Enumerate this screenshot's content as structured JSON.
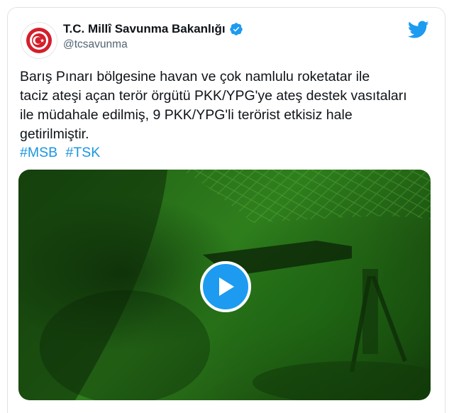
{
  "tweet": {
    "display_name": "T.C. Millî Savunma Bakanlığı",
    "handle": "@tcsavunma",
    "text_lines": [
      "Barış Pınarı bölgesine havan ve çok namlulu roketatar ile",
      "taciz ateşi açan terör örgütü PKK/YPG'ye ateş destek vasıtaları",
      "ile müdahale edilmiş, 9 PKK/YPG'li terörist etkisiz hale",
      "getirilmiştir."
    ],
    "hashtags": [
      "#MSB",
      "#TSK"
    ]
  },
  "icons": {
    "avatar": "ministry-seal-icon",
    "verified": "verified-badge-icon",
    "brand": "twitter-bird-icon",
    "play": "play-icon"
  },
  "colors": {
    "accent": "#1d9bf0",
    "hashtag": "#1b95e0",
    "seal_red": "#d31f2b",
    "video_tint": "#2f7f1d"
  }
}
